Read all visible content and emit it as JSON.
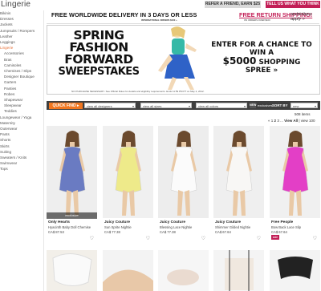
{
  "brand": "Lingerie",
  "header": {
    "refer_label": "REFER A FRIEND, EARN $25",
    "tell_label": "TELL US WHAT YOU THINK"
  },
  "sidebar": {
    "items": [
      {
        "label": "Bikinis",
        "level": "top"
      },
      {
        "label": "Dresses",
        "level": "top"
      },
      {
        "label": "Jackets",
        "level": "top"
      },
      {
        "label": "Jumpsuits / Rompers",
        "level": "top"
      },
      {
        "label": "Leather",
        "level": "top"
      },
      {
        "label": "Leggings",
        "level": "top"
      },
      {
        "label": "Lingerie",
        "level": "top",
        "active": true
      },
      {
        "label": "Accessories",
        "level": "sub"
      },
      {
        "label": "Bras",
        "level": "sub"
      },
      {
        "label": "Camisoles",
        "level": "sub"
      },
      {
        "label": "Chemises / Slips",
        "level": "sub"
      },
      {
        "label": "Designer Boutique",
        "level": "sub"
      },
      {
        "label": "Garters",
        "level": "sub"
      },
      {
        "label": "Panties",
        "level": "sub"
      },
      {
        "label": "Robes",
        "level": "sub"
      },
      {
        "label": "Shapewear",
        "level": "sub"
      },
      {
        "label": "Sleepwear",
        "level": "sub"
      },
      {
        "label": "Teddies",
        "level": "sub"
      },
      {
        "label": "Loungewear / Yoga",
        "level": "top"
      },
      {
        "label": "Maternity",
        "level": "top"
      },
      {
        "label": "Outerwear",
        "level": "top"
      },
      {
        "label": "Pants",
        "level": "top"
      },
      {
        "label": "Shorts",
        "level": "top"
      },
      {
        "label": "Skirts",
        "level": "top"
      },
      {
        "label": "Suiting",
        "level": "top"
      },
      {
        "label": "Sweaters / Knits",
        "level": "top"
      },
      {
        "label": "Swimwear",
        "level": "top"
      },
      {
        "label": "Tops",
        "level": "top"
      }
    ]
  },
  "delivery": {
    "headline": "FREE WORLDWIDE DELIVERY IN 3 DAYS OR LESS",
    "headline_sub": "INTERNATIONAL ORDERS $100 +",
    "return": "FREE RETURN SHIPPING!",
    "return_sub": "ON ORDERS OVER $100",
    "restrictions": "restrictions apply »"
  },
  "promo": {
    "lines": [
      "SPRING",
      "FASHION",
      "FORWARD",
      "SWEEPSTAKES"
    ],
    "enter_line1": "ENTER FOR A CHANCE TO WIN A",
    "amount": "$5000",
    "enter_line2": "SHOPPING SPREE »",
    "fineprint": "NO PURCHASE NECESSARY. See Official Rules for details and eligibility requirements. Ends 11:59 PM PT on May 2, 2012."
  },
  "filters": {
    "quickfind": "QUICK FIND ▸",
    "designers": "view all designers",
    "sizes": "view all sizes",
    "colors": "view all colors",
    "new": "NEW",
    "exclusives": "exclusives",
    "sort_label": "SORT BY",
    "sort_value": "new"
  },
  "results": {
    "count": "508 items",
    "pager_prefix": "« 1",
    "pager_current": "2",
    "pager_rest": "3 ...",
    "view_all": "View All",
    "pager_suffix": "| view 100"
  },
  "products": [
    {
      "brand": "Only Hearts",
      "name": "Hyacinth Baby Doll Chemise",
      "price": "CA$ 87.53",
      "exclusive": true,
      "exclusive_label": "exclusive",
      "dress_color": "#6a7bc2",
      "bg": "#eeeeee"
    },
    {
      "brand": "Juicy Couture",
      "name": "Sun Sprite Nightie",
      "price": "CA$ 77.38",
      "exclusive": false,
      "dress_color": "#eeea8a",
      "bg": "#f0f0f0"
    },
    {
      "brand": "Juicy Couture",
      "name": "Blessing Lace Nightie",
      "price": "CA$ 77.38",
      "exclusive": false,
      "dress_color": "#fbfbfb",
      "bg": "#ededed"
    },
    {
      "brand": "Juicy Couture",
      "name": "Shimmer Gilded Nightie",
      "price": "CA$ 67.64",
      "exclusive": false,
      "dress_color": "#f8f7f5",
      "bg": "#efefef"
    },
    {
      "brand": "Free People",
      "name": "Bow Back Lace Slip",
      "price": "CA$ 67.64",
      "exclusive": false,
      "sale": true,
      "sale_label": "sale",
      "dress_color": "#e33fc6",
      "bg": "#f0f0f0"
    }
  ],
  "colors": {
    "accent": "#c21e56",
    "quickfind": "#f1761f",
    "filterbar": "#3f3f3f",
    "active_nav": "#e8733b"
  }
}
